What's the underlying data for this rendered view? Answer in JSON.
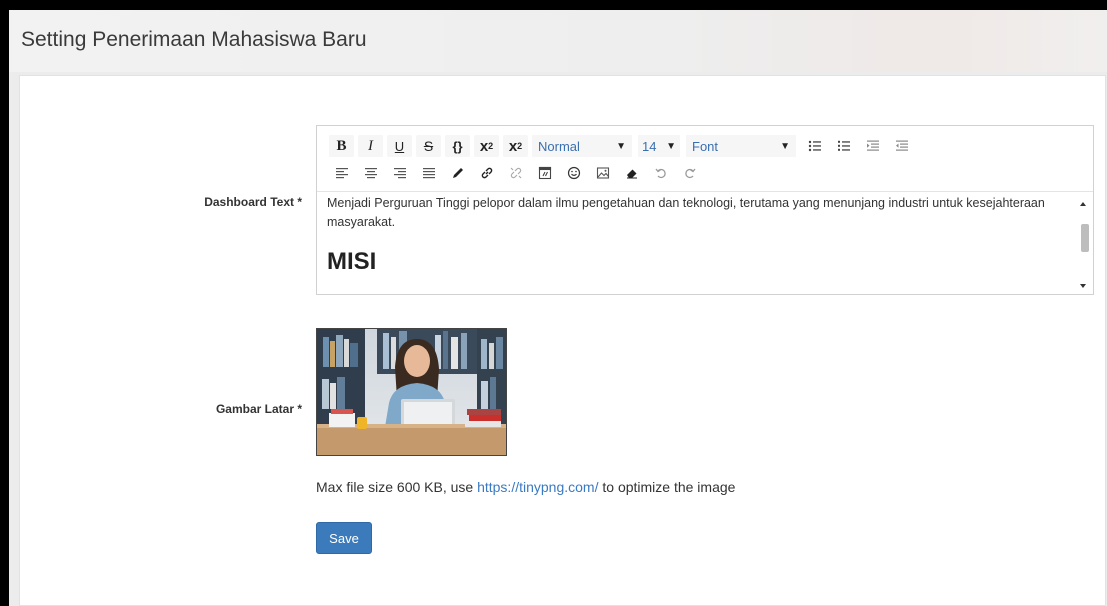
{
  "header": {
    "title": "Setting Penerimaan Mahasiswa Baru"
  },
  "form": {
    "dashboard_label": "Dashboard Text *",
    "image_label": "Gambar Latar *",
    "editor": {
      "toolbar": {
        "bold": "B",
        "italic": "I",
        "underline": "U",
        "strike": "S",
        "code": "{}",
        "superscript_base": "x",
        "superscript_mark": "2",
        "subscript_base": "x",
        "subscript_mark": "2",
        "format_select": "Normal",
        "size_select": "14",
        "font_select": "Font"
      },
      "content": {
        "paragraph": "Menjadi Perguruan Tinggi pelopor dalam ilmu pengetahuan dan teknologi, terutama yang menunjang industri untuk kesejahteraan masyarakat.",
        "heading": "MISI"
      }
    },
    "help": {
      "before": "Max file size 600 KB, use ",
      "link": "https://tinypng.com/",
      "after": " to optimize the image"
    },
    "save_label": "Save"
  },
  "colors": {
    "primary_button": "#3c7bbb",
    "link": "#3a7ac2",
    "select_text": "#3a6fb0"
  }
}
